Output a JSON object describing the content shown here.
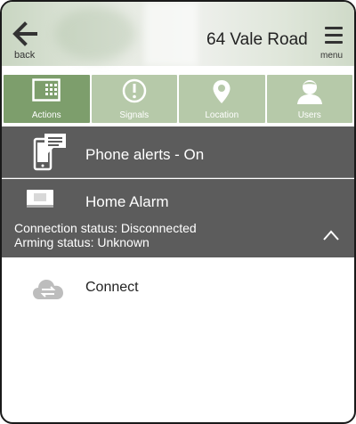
{
  "header": {
    "back_label": "back",
    "address": "64 Vale Road",
    "menu_label": "menu"
  },
  "tabs": [
    {
      "label": "Actions",
      "icon": "keypad-icon",
      "active": true
    },
    {
      "label": "Signals",
      "icon": "alert-circle-icon",
      "active": false
    },
    {
      "label": "Location",
      "icon": "location-pin-icon",
      "active": false
    },
    {
      "label": "Users",
      "icon": "user-icon",
      "active": false
    }
  ],
  "phone_alerts": {
    "label": "Phone alerts - On",
    "icon": "phone-chat-icon"
  },
  "home_alarm": {
    "title": "Home Alarm",
    "connection_status": "Connection status: Disconnected",
    "arming_status": "Arming status: Unknown",
    "icon": "alarm-panel-icon"
  },
  "connect": {
    "label": "Connect",
    "icon": "cloud-sync-icon"
  },
  "colors": {
    "tab_active": "#7d9e6c",
    "tab_inactive": "#b6c9a9",
    "panel_dark": "#5c5c5c"
  }
}
